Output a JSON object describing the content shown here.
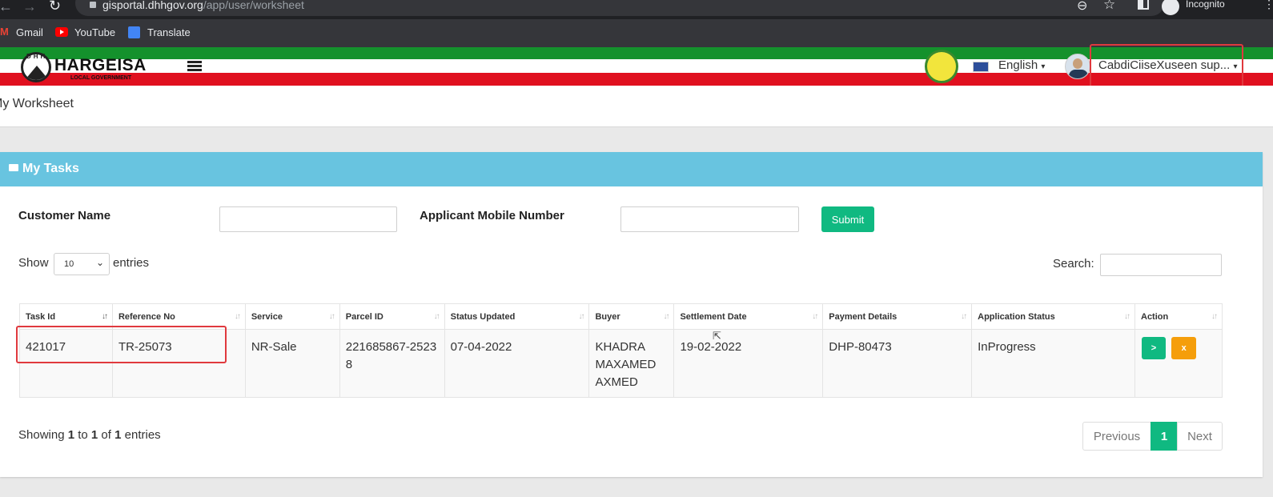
{
  "browser": {
    "url_host": "gisportal.dhhgov.org",
    "url_path": "/app/user/worksheet",
    "incognito_label": "Incognito",
    "bookmarks": [
      "Gmail",
      "YouTube",
      "Translate"
    ]
  },
  "header": {
    "logo_title": "HARGEISA",
    "logo_subtitle": "LOCAL GOVERNMENT",
    "logo_badge": "DHH",
    "language": "English",
    "user_name": "CabdiCiiseXuseen sup..."
  },
  "page": {
    "breadcrumb": "My Worksheet"
  },
  "panel": {
    "title": "My Tasks",
    "filters": {
      "customer_name_label": "Customer Name",
      "customer_name_value": "",
      "mobile_label": "Applicant Mobile Number",
      "mobile_value": "",
      "submit_label": "Submit"
    },
    "length": {
      "show_label": "Show",
      "value": "10",
      "entries_label": "entries"
    },
    "search_label": "Search:",
    "search_value": "",
    "table": {
      "columns": [
        "Task Id",
        "Reference No",
        "Service",
        "Parcel ID",
        "Status Updated",
        "Buyer",
        "Settlement Date",
        "Payment Details",
        "Application Status",
        "Action"
      ],
      "rows": [
        {
          "task_id": "421017",
          "reference_no": "TR-25073",
          "service": "NR-Sale",
          "parcel_id": "221685867-25238",
          "status_updated": "07-04-2022",
          "buyer": "KHADRA MAXAMED AXMED",
          "settlement_date": "19-02-2022",
          "payment_details": "DHP-80473",
          "application_status": "InProgress",
          "action_next": ">",
          "action_cancel": "x"
        }
      ]
    },
    "info": {
      "prefix": "Showing ",
      "from": "1",
      "to_word": " to ",
      "to": "1",
      "of_word": " of ",
      "total": "1",
      "suffix": " entries"
    },
    "pagination": {
      "previous": "Previous",
      "current": "1",
      "next": "Next"
    }
  },
  "colors": {
    "header_blue": "#68c4e0",
    "stripe_green": "#14912c",
    "stripe_red": "#e0101f",
    "btn_green": "#10b981",
    "btn_orange": "#f59e0b",
    "highlight_red": "#e0393e"
  }
}
